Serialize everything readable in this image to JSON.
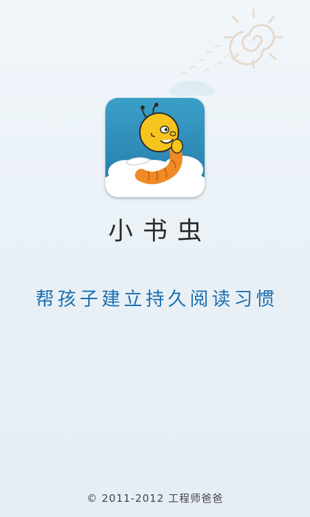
{
  "splash": {
    "app_name": "小书虫",
    "slogan": "帮孩子建立持久阅读习惯",
    "copyright": "© 2011-2012 工程师爸爸"
  },
  "icons": {
    "app_icon": "bookworm-mascot-icon",
    "decoration": "sun-and-cloud-decoration"
  },
  "colors": {
    "background": "#eaf1f7",
    "slogan": "#1d6fb0",
    "icon_sky": "#2f8fb9",
    "mascot_yellow": "#f7c31d",
    "mascot_orange": "#f08a24"
  }
}
